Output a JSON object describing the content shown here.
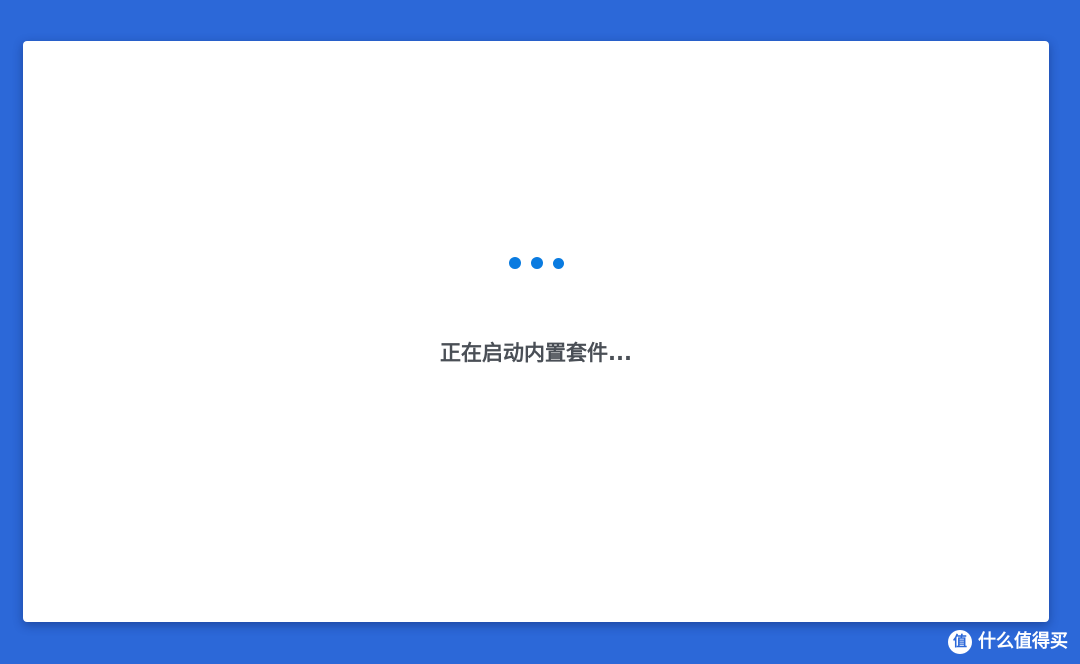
{
  "dialog": {
    "status_text": "正在启动内置套件..."
  },
  "loader": {
    "dot_count": 3,
    "dot_color": "#0a7be0"
  },
  "watermark": {
    "text": "什么值得买",
    "logo_glyph": "值",
    "logo_icon": "smzdm-logo-icon"
  },
  "colors": {
    "background": "#2c68d8",
    "card": "#ffffff",
    "text": "#4a4f56"
  }
}
